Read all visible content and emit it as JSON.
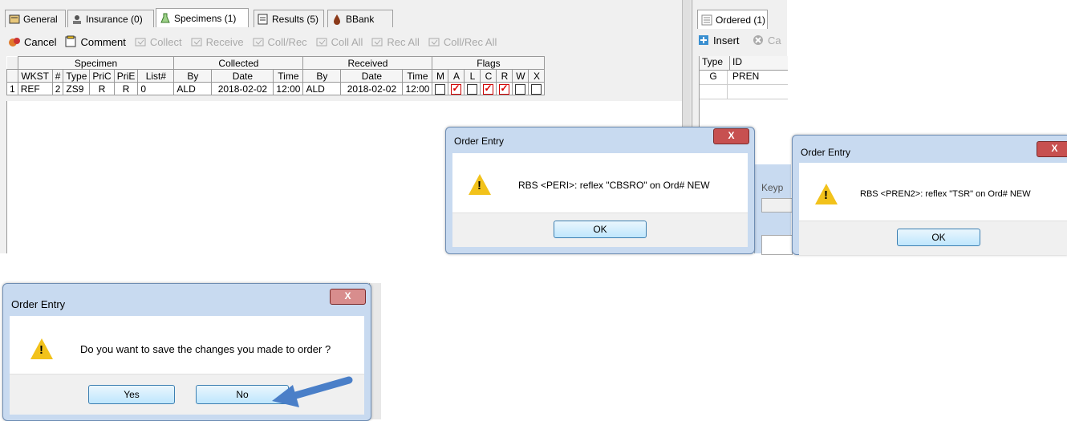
{
  "tabs": [
    {
      "label": "General",
      "icon": "general-icon"
    },
    {
      "label": "Insurance (0)",
      "icon": "insurance-icon"
    },
    {
      "label": "Specimens (1)",
      "icon": "flask-icon"
    },
    {
      "label": "Results (5)",
      "icon": "results-icon"
    },
    {
      "label": "BBank",
      "icon": "blood-drop-icon"
    }
  ],
  "toolbar": {
    "cancel": "Cancel",
    "comment": "Comment",
    "collect": "Collect",
    "receive": "Receive",
    "coll_rec": "Coll/Rec",
    "coll_all": "Coll All",
    "rec_all": "Rec All",
    "coll_rec_all": "Coll/Rec All"
  },
  "grid": {
    "groups": [
      "Specimen",
      "Collected",
      "Received",
      "Flags"
    ],
    "columns": [
      "WKST",
      "#",
      "Type",
      "PriC",
      "PriE",
      "List#",
      "By",
      "Date",
      "Time",
      "By",
      "Date",
      "Time",
      "M",
      "A",
      "L",
      "C",
      "R",
      "W",
      "X"
    ],
    "rows": [
      {
        "row_num": "1",
        "wkst": "REF",
        "num": "2",
        "type": "ZS9",
        "pric": "R",
        "prie": "R",
        "list": "0",
        "coll_by": "ALD",
        "coll_date": "2018-02-02",
        "coll_time": "12:00",
        "rec_by": "ALD",
        "rec_date": "2018-02-02",
        "rec_time": "12:00",
        "flags": [
          false,
          true,
          false,
          true,
          true,
          false,
          false
        ]
      }
    ]
  },
  "right_panel": {
    "tab": "Ordered (1)",
    "insert": "Insert",
    "cancel_partial": "Ca",
    "columns": [
      "Type",
      "ID"
    ],
    "rows": [
      {
        "type": "G",
        "id": "PREN"
      }
    ]
  },
  "partial_window": {
    "label": "Keyp"
  },
  "dialogs": {
    "d1": {
      "title": "Order Entry",
      "message": "RBS <PERI>: reflex \"CBSRO\" on Ord# NEW",
      "ok": "OK",
      "close": "X"
    },
    "d2": {
      "title": "Order Entry",
      "message": "RBS <PREN2>: reflex \"TSR\" on Ord# NEW",
      "ok": "OK",
      "close": "X"
    },
    "d3": {
      "title": "Order Entry",
      "message": "Do you want to save the changes you made to order ?",
      "yes": "Yes",
      "no": "No",
      "close": "X"
    }
  },
  "colors": {
    "accent": "#3c7fb1",
    "close_red": "#c75050",
    "warning": "#f2c21b",
    "arrow": "#4a7fc8"
  }
}
